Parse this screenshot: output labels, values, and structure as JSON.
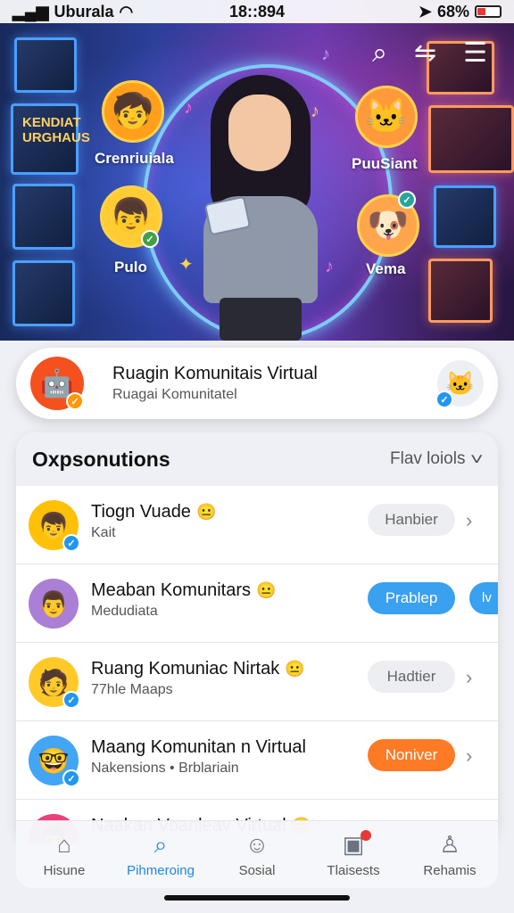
{
  "status_bar": {
    "carrier": "Uburala",
    "time": "18::894",
    "battery": "68%"
  },
  "hero": {
    "labels": {
      "top_left": "Crenriuiala",
      "bottom_left": "Pulo",
      "top_right": "PuuSiant",
      "bottom_right": "Vema"
    },
    "poster_text": "KENDIAT URGHAUS"
  },
  "banner": {
    "title": "Ruagin Komunitais Virtual",
    "subtitle": "Ruagai Komunitatel"
  },
  "panel": {
    "title": "Oxpsonutions",
    "filter": "Flav loiols"
  },
  "rows": [
    {
      "title": "Tiogn Vuade",
      "emoji": "😐",
      "subtitle": "Kait",
      "button": "Hanbier",
      "button_style": "grey"
    },
    {
      "title": "Meaban Komunitars",
      "emoji": "😐",
      "subtitle": "Medudiata",
      "button": "Prablep",
      "button_style": "blue",
      "extra": "lv"
    },
    {
      "title": "Ruang Komuniac Nirtak",
      "emoji": "😐",
      "subtitle": "77hle Maaps",
      "button": "Hadtier",
      "button_style": "grey"
    },
    {
      "title": "Maang Komunitan n Virtual",
      "emoji": "",
      "subtitle": "Nakensions • Brblariain",
      "button": "Noniver",
      "button_style": "orange"
    },
    {
      "title": "Naakan Voanleav Virtual",
      "emoji": "😐",
      "subtitle": "",
      "button": "",
      "button_style": "grey"
    }
  ],
  "nav": [
    {
      "label": "Hisune",
      "icon": "home-icon"
    },
    {
      "label": "Pihmeroing",
      "icon": "search-icon"
    },
    {
      "label": "Sosial",
      "icon": "smiley-icon"
    },
    {
      "label": "Tlaisests",
      "icon": "tickets-icon"
    },
    {
      "label": "Rehamis",
      "icon": "profile-icon"
    }
  ],
  "colors": {
    "accent": "#1e88e5",
    "blue_button": "#3aa0f0",
    "orange_button": "#ff7a24"
  }
}
